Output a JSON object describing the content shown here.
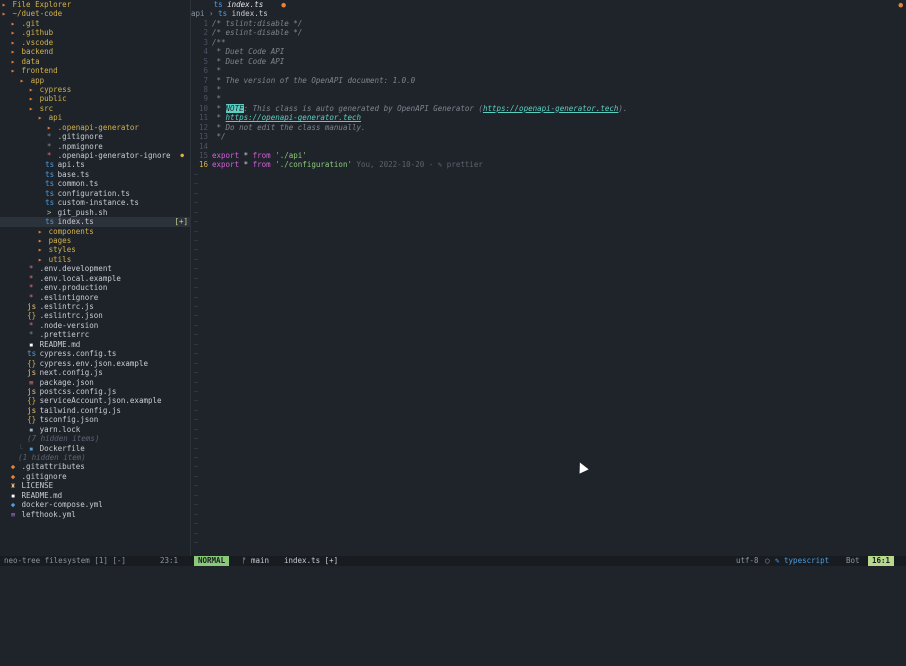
{
  "tree": {
    "header": "File Explorer",
    "rows": [
      {
        "indent": 0,
        "type": "dir",
        "open": true,
        "icon": "▸",
        "label": "~/duet-code"
      },
      {
        "indent": 1,
        "type": "dir",
        "icon": "▸",
        "label": ".git"
      },
      {
        "indent": 1,
        "type": "dir",
        "icon": "▸",
        "label": ".github"
      },
      {
        "indent": 1,
        "type": "dir",
        "icon": "▸",
        "label": ".vscode"
      },
      {
        "indent": 1,
        "type": "dir",
        "icon": "▸",
        "label": "backend"
      },
      {
        "indent": 1,
        "type": "dir",
        "icon": "▸",
        "label": "data"
      },
      {
        "indent": 1,
        "type": "dir",
        "open": true,
        "icon": "▸",
        "label": "frontend"
      },
      {
        "indent": 2,
        "type": "dir",
        "open": true,
        "icon": "▸",
        "label": "app"
      },
      {
        "indent": 3,
        "type": "dir",
        "icon": "▸",
        "label": "cypress"
      },
      {
        "indent": 3,
        "type": "dir",
        "icon": "▸",
        "label": "public"
      },
      {
        "indent": 3,
        "type": "dir",
        "open": true,
        "icon": "▸",
        "label": "src"
      },
      {
        "indent": 4,
        "type": "dir",
        "open": true,
        "icon": "▸",
        "label": "api"
      },
      {
        "indent": 5,
        "type": "dir",
        "icon": "▸",
        "label": ".openapi-generator"
      },
      {
        "indent": 5,
        "type": "file",
        "icon": "*",
        "ic": "dot",
        "label": ".gitignore"
      },
      {
        "indent": 5,
        "type": "file",
        "icon": "*",
        "ic": "dot",
        "label": ".npmignore"
      },
      {
        "indent": 5,
        "type": "file",
        "icon": "*",
        "ic": "gear",
        "label": ".openapi-generator-ignore",
        "gitdot": true
      },
      {
        "indent": 5,
        "type": "file",
        "icon": "ts",
        "ic": "ts",
        "label": "api.ts"
      },
      {
        "indent": 5,
        "type": "file",
        "icon": "ts",
        "ic": "ts",
        "label": "base.ts"
      },
      {
        "indent": 5,
        "type": "file",
        "icon": "ts",
        "ic": "ts",
        "label": "common.ts"
      },
      {
        "indent": 5,
        "type": "file",
        "icon": "ts",
        "ic": "ts",
        "label": "configuration.ts"
      },
      {
        "indent": 5,
        "type": "file",
        "icon": "ts",
        "ic": "ts",
        "label": "custom-instance.ts"
      },
      {
        "indent": 5,
        "type": "file",
        "icon": ">",
        "ic": "sh",
        "label": "git_push.sh"
      },
      {
        "indent": 5,
        "type": "file",
        "icon": "ts",
        "ic": "ts",
        "label": "index.ts",
        "selected": true,
        "badge": "[+]"
      },
      {
        "indent": 4,
        "type": "dir",
        "icon": "▸",
        "label": "components"
      },
      {
        "indent": 4,
        "type": "dir",
        "icon": "▸",
        "label": "pages"
      },
      {
        "indent": 4,
        "type": "dir",
        "icon": "▸",
        "label": "styles"
      },
      {
        "indent": 4,
        "type": "dir",
        "icon": "▸",
        "label": "utils"
      },
      {
        "indent": 3,
        "type": "file",
        "icon": "*",
        "ic": "gear",
        "label": ".env.development"
      },
      {
        "indent": 3,
        "type": "file",
        "icon": "*",
        "ic": "gear",
        "label": ".env.local.example"
      },
      {
        "indent": 3,
        "type": "file",
        "icon": "*",
        "ic": "gear",
        "label": ".env.production"
      },
      {
        "indent": 3,
        "type": "file",
        "icon": "*",
        "ic": "gear",
        "label": ".eslintignore"
      },
      {
        "indent": 3,
        "type": "file",
        "icon": "js",
        "ic": "js",
        "label": ".eslintrc.js"
      },
      {
        "indent": 3,
        "type": "file",
        "icon": "{}",
        "ic": "json",
        "label": ".eslintrc.json"
      },
      {
        "indent": 3,
        "type": "file",
        "icon": "*",
        "ic": "gear",
        "label": ".node-version"
      },
      {
        "indent": 3,
        "type": "file",
        "icon": "*",
        "ic": "dot",
        "label": ".prettierrc"
      },
      {
        "indent": 3,
        "type": "file",
        "icon": "▪",
        "ic": "md",
        "label": "README.md"
      },
      {
        "indent": 3,
        "type": "file",
        "icon": "ts",
        "ic": "ts",
        "label": "cypress.config.ts"
      },
      {
        "indent": 3,
        "type": "file",
        "icon": "{}",
        "ic": "json",
        "label": "cypress.env.json.example"
      },
      {
        "indent": 3,
        "type": "file",
        "icon": "js",
        "ic": "js",
        "label": "next.config.js"
      },
      {
        "indent": 3,
        "type": "file",
        "icon": "≡",
        "ic": "gear",
        "label": "package.json"
      },
      {
        "indent": 3,
        "type": "file",
        "icon": "js",
        "ic": "js",
        "label": "postcss.config.js"
      },
      {
        "indent": 3,
        "type": "file",
        "icon": "{}",
        "ic": "json",
        "label": "serviceAccount.json.example"
      },
      {
        "indent": 3,
        "type": "file",
        "icon": "js",
        "ic": "js",
        "label": "tailwind.config.js"
      },
      {
        "indent": 3,
        "type": "file",
        "icon": "{}",
        "ic": "json",
        "label": "tsconfig.json"
      },
      {
        "indent": 3,
        "type": "file",
        "icon": "▪",
        "ic": "lock",
        "label": "yarn.lock"
      },
      {
        "indent": 3,
        "type": "hidden",
        "icon": "",
        "label": "(7 hidden items)"
      },
      {
        "indent": 2,
        "type": "file",
        "icon": "▪",
        "ic": "dock",
        "label": "Dockerfile",
        "prefix": "└ "
      },
      {
        "indent": 2,
        "type": "hidden",
        "icon": "",
        "label": "(1 hidden item)"
      },
      {
        "indent": 1,
        "type": "file",
        "icon": "◆",
        "ic": "git",
        "label": ".gitattributes"
      },
      {
        "indent": 1,
        "type": "file",
        "icon": "◆",
        "ic": "git",
        "label": ".gitignore"
      },
      {
        "indent": 1,
        "type": "file",
        "icon": "♜",
        "ic": "lic",
        "label": "LICENSE"
      },
      {
        "indent": 1,
        "type": "file",
        "icon": "▪",
        "ic": "md",
        "label": "README.md"
      },
      {
        "indent": 1,
        "type": "file",
        "icon": "◆",
        "ic": "dock",
        "label": "docker-compose.yml"
      },
      {
        "indent": 1,
        "type": "file",
        "icon": "≡",
        "ic": "yml",
        "label": "lefthook.yml"
      }
    ]
  },
  "editor": {
    "tab_icon": "ts",
    "tab_name": "index.ts",
    "tab_modified": "●",
    "breadcrumb": [
      "api",
      "index.ts"
    ],
    "lines": [
      {
        "n": "1",
        "parts": [
          [
            "cm",
            "/* tslint:disable */"
          ]
        ]
      },
      {
        "n": "2",
        "parts": [
          [
            "cm",
            "/* eslint-disable */"
          ]
        ]
      },
      {
        "n": "3",
        "parts": [
          [
            "cm",
            "/**"
          ]
        ]
      },
      {
        "n": "4",
        "parts": [
          [
            "cm",
            " * Duet Code API"
          ]
        ]
      },
      {
        "n": "5",
        "parts": [
          [
            "cm",
            " * Duet Code API"
          ]
        ]
      },
      {
        "n": "6",
        "parts": [
          [
            "cm",
            " *"
          ]
        ]
      },
      {
        "n": "7",
        "parts": [
          [
            "cm",
            " * The version of the OpenAPI document: 1.0.0"
          ]
        ]
      },
      {
        "n": "8",
        "parts": [
          [
            "cm",
            " *"
          ]
        ]
      },
      {
        "n": "9",
        "parts": [
          [
            "cm",
            " *"
          ]
        ]
      },
      {
        "n": "10",
        "parts": [
          [
            "cm",
            " * "
          ],
          [
            "note",
            "NOTE"
          ],
          [
            "cm",
            ": This class is auto generated by OpenAPI Generator ("
          ],
          [
            "link",
            "https://openapi-generator.tech"
          ],
          [
            "cm",
            ")."
          ]
        ]
      },
      {
        "n": "11",
        "parts": [
          [
            "cm",
            " * "
          ],
          [
            "link",
            "https://openapi-generator.tech"
          ]
        ]
      },
      {
        "n": "12",
        "parts": [
          [
            "cm",
            " * Do not edit the class manually."
          ]
        ]
      },
      {
        "n": "13",
        "parts": [
          [
            "cm",
            " */"
          ]
        ]
      },
      {
        "n": "14",
        "parts": []
      },
      {
        "n": "15",
        "parts": [
          [
            "kw",
            "export"
          ],
          [
            "txt",
            " * "
          ],
          [
            "kw",
            "from"
          ],
          [
            "txt",
            " "
          ],
          [
            "str",
            "'./api'"
          ]
        ]
      },
      {
        "n": "16",
        "cur": true,
        "parts": [
          [
            "kw",
            "export"
          ],
          [
            "txt",
            " * "
          ],
          [
            "kw",
            "from"
          ],
          [
            "txt",
            " "
          ],
          [
            "str",
            "'./configuration'"
          ],
          [
            "blame",
            " You, 2022-10-20 - ✎ prettier"
          ]
        ]
      }
    ],
    "tilde_count": 40
  },
  "status": {
    "left": "neo-tree filesystem [1] [-]",
    "left_pos": "23:1",
    "mode": "NORMAL",
    "branch": "ᚠ main",
    "file": "index.ts [+]",
    "encoding": "utf-8",
    "os_icon": "◯",
    "filetype": "✎ typescript",
    "scroll": "Bot",
    "pos": "16:1"
  }
}
